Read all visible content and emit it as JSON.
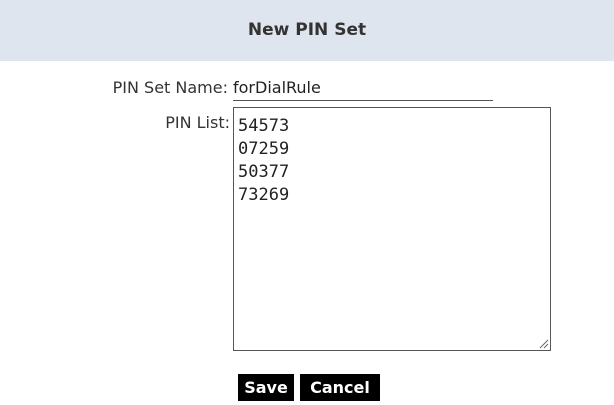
{
  "header": {
    "title": "New PIN Set"
  },
  "form": {
    "name_label": "PIN Set Name:",
    "name_value": "forDialRule",
    "list_label": "PIN List:",
    "list_value": "54573\n07259\n50377\n73269"
  },
  "buttons": {
    "save_label": "Save",
    "cancel_label": "Cancel"
  },
  "colors": {
    "header_background": "#dfe5ee",
    "button_background": "#000000",
    "button_text": "#ffffff"
  },
  "icons": {
    "textarea_resize": "resize-grip-icon"
  }
}
